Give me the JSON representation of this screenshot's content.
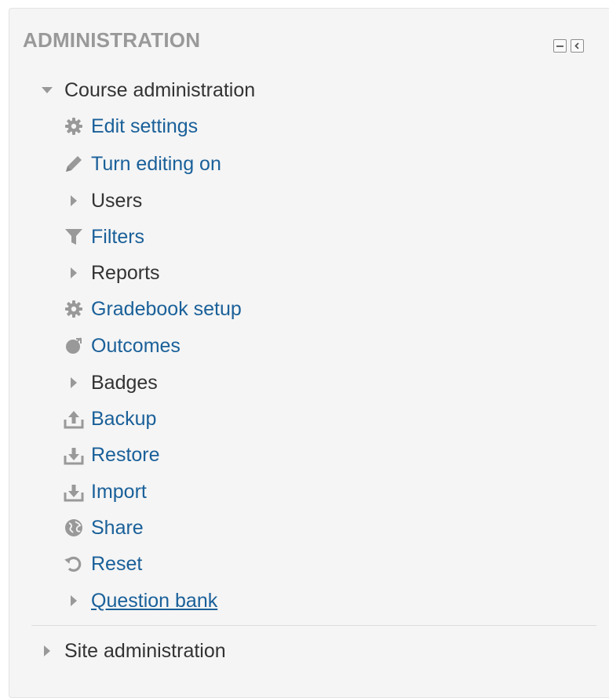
{
  "block": {
    "title": "ADMINISTRATION",
    "controls": {
      "collapse_icon": "minus-box-icon",
      "dock_icon": "dock-left-icon"
    }
  },
  "course_admin": {
    "label": "Course administration",
    "icon": "triangle-down-icon",
    "expanded": true,
    "items": [
      {
        "label": "Edit settings",
        "icon": "gear-icon"
      },
      {
        "label": "Turn editing on",
        "icon": "pencil-icon"
      },
      {
        "label": "Users",
        "icon": "triangle-right-icon"
      },
      {
        "label": "Filters",
        "icon": "filter-icon"
      },
      {
        "label": "Reports",
        "icon": "triangle-right-icon"
      },
      {
        "label": "Gradebook setup",
        "icon": "gear-icon"
      },
      {
        "label": "Outcomes",
        "icon": "outcomes-icon"
      },
      {
        "label": "Badges",
        "icon": "triangle-right-icon"
      },
      {
        "label": "Backup",
        "icon": "upload-icon"
      },
      {
        "label": "Restore",
        "icon": "download-icon"
      },
      {
        "label": "Import",
        "icon": "download-icon"
      },
      {
        "label": "Share",
        "icon": "globe-icon"
      },
      {
        "label": "Reset",
        "icon": "reset-icon"
      },
      {
        "label": "Question bank",
        "icon": "triangle-right-icon"
      }
    ]
  },
  "site_admin": {
    "label": "Site administration",
    "icon": "triangle-right-icon",
    "expanded": false
  },
  "colors": {
    "link": "#1a6099",
    "text": "#333333",
    "header": "#999999",
    "icon": "#999999",
    "panel_bg": "#f5f5f5"
  }
}
